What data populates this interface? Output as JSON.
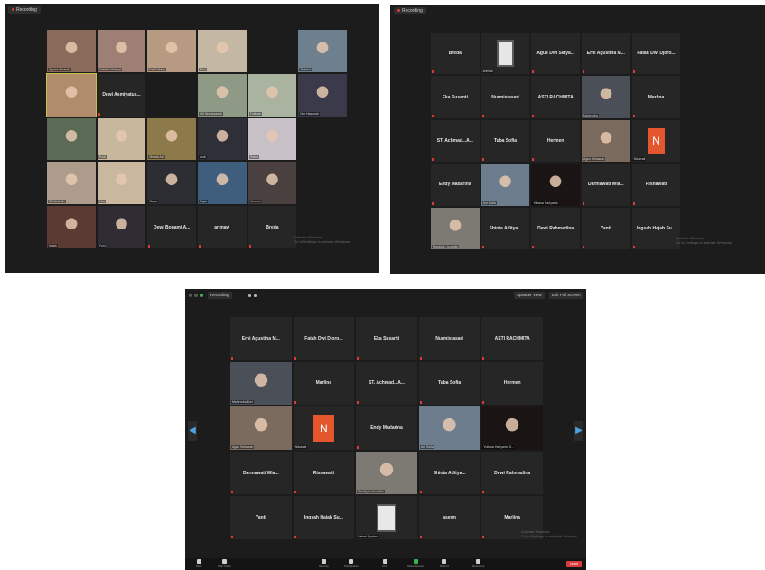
{
  "shot1": {
    "recording_label": "Recording",
    "tiles": [
      {
        "cap": "Alyssa Amanda",
        "kind": "photo",
        "color": "#8a6a5a"
      },
      {
        "cap": "Mahfud Hidayat",
        "kind": "photo",
        "color": "#9e7f73"
      },
      {
        "cap": "Fadli Akbar",
        "kind": "photo",
        "color": "#b79a82"
      },
      {
        "cap": "Rina",
        "kind": "photo",
        "color": "#c4b8a4"
      },
      {
        "cap": "",
        "kind": "empty"
      },
      {
        "cap": "Syahrul",
        "kind": "photo",
        "color": "#6e7f8e"
      },
      {
        "cap": "",
        "kind": "photo",
        "color": "#b08c6a",
        "active": true
      },
      {
        "name": "Dewi Asmiyatus...",
        "cap": "",
        "kind": "name"
      },
      {
        "cap": "",
        "kind": "empty"
      },
      {
        "cap": "Siti Nurhasanah",
        "kind": "photo",
        "color": "#8f9a86"
      },
      {
        "cap": "Fatimah",
        "kind": "photo",
        "color": "#a9b3a0"
      },
      {
        "cap": "Nur Hasanah",
        "kind": "photo",
        "color": "#3a3a4a"
      },
      {
        "cap": "",
        "kind": "photo",
        "color": "#5b6a55"
      },
      {
        "cap": "Rudi",
        "kind": "photo",
        "color": "#c7b89d"
      },
      {
        "cap": "Mellati Asri",
        "kind": "photo",
        "color": "#8c7a4a"
      },
      {
        "cap": "Andi",
        "kind": "photo",
        "color": "#2f2f38"
      },
      {
        "cap": "Ratna",
        "kind": "photo",
        "color": "#c7c0c6"
      },
      {
        "cap": "",
        "kind": "empty"
      },
      {
        "cap": "Siti Aminah",
        "kind": "photo",
        "color": "#ad9c8c"
      },
      {
        "cap": "Lina",
        "kind": "photo",
        "color": "#c9b7a0"
      },
      {
        "cap": "Maya",
        "kind": "photo",
        "color": "#2d2d34"
      },
      {
        "cap": "Fajar",
        "kind": "photo",
        "color": "#3f5e7e"
      },
      {
        "cap": "Hendra",
        "kind": "photo",
        "color": "#4a4040"
      },
      {
        "cap": "",
        "kind": "empty"
      },
      {
        "cap": "Indah",
        "kind": "photo",
        "color": "#5a3b33"
      },
      {
        "cap": "Yuni",
        "kind": "photo",
        "color": "#2f2c34"
      },
      {
        "name": "Dewi Bonami A...",
        "cap": "",
        "kind": "name"
      },
      {
        "name": "arimaw",
        "cap": "",
        "kind": "name"
      },
      {
        "name": "Breda",
        "cap": "",
        "kind": "name"
      },
      {
        "cap": "",
        "kind": "empty"
      }
    ],
    "watermark_line1": "Activate Windows",
    "watermark_line2": "Go to Settings to activate Windows."
  },
  "shot2": {
    "recording_label": "Recording",
    "tiles": [
      {
        "name": "Breda",
        "kind": "name"
      },
      {
        "cap": "arimaw",
        "kind": "icon",
        "color": "#e6e6e6"
      },
      {
        "name": "Agus Dwi Setya...",
        "kind": "name"
      },
      {
        "name": "Erni Agustina M...",
        "kind": "name"
      },
      {
        "name": "Fatah Dwi Djoro...",
        "kind": "name"
      },
      {
        "kind": "empty"
      },
      {
        "name": "Eka Susanti",
        "kind": "name"
      },
      {
        "name": "Nurmistasari",
        "kind": "name"
      },
      {
        "name": "ASTI RACHMITA",
        "kind": "name"
      },
      {
        "cap": "Mahendra",
        "kind": "photo",
        "color": "#4a4f58"
      },
      {
        "name": "Marlina",
        "kind": "name"
      },
      {
        "kind": "empty"
      },
      {
        "name": "ST. Achmad...A...",
        "kind": "name"
      },
      {
        "name": "Tuba Sofia",
        "kind": "name"
      },
      {
        "name": "Hermen",
        "kind": "name"
      },
      {
        "cap": "Agus Setiawan",
        "kind": "photo",
        "color": "#7a6b5e"
      },
      {
        "cap": "Nikamal",
        "kind": "n"
      },
      {
        "kind": "empty"
      },
      {
        "name": "Endy Madarina",
        "kind": "name"
      },
      {
        "cap": "Ani Sofia",
        "kind": "photo",
        "color": "#6d7d8e"
      },
      {
        "cap": "Yuliana Hariyanto",
        "kind": "photo",
        "color": "#1a1414"
      },
      {
        "name": "Darmawati Wia...",
        "kind": "name"
      },
      {
        "name": "Risnawati",
        "kind": "name"
      },
      {
        "kind": "empty"
      },
      {
        "cap": "Mardiyah Junaidin",
        "kind": "photo",
        "color": "#7c7a72"
      },
      {
        "name": "Shinta Aditya...",
        "kind": "name"
      },
      {
        "name": "Dewi Rahmadina",
        "kind": "name"
      },
      {
        "name": "Yanti",
        "kind": "name"
      },
      {
        "name": "Ingsah Hajah Su...",
        "kind": "name"
      },
      {
        "kind": "empty"
      }
    ],
    "watermark_line1": "Activate Windows",
    "watermark_line2": "Go to Settings to activate Windows."
  },
  "shot3": {
    "recording_label": "Recording",
    "speaker_view_label": "Speaker View",
    "exit_fullscreen_label": "Exit Full Screen",
    "nav_prev": "◀",
    "nav_next": "▶",
    "tiles": [
      {
        "name": "Erni Agustina M...",
        "kind": "name"
      },
      {
        "name": "Fatah Dwi Djoro...",
        "kind": "name"
      },
      {
        "name": "Eka Susanti",
        "kind": "name"
      },
      {
        "name": "Nurmistasari",
        "kind": "name"
      },
      {
        "name": "ASTI RACHMITA",
        "kind": "name"
      },
      {
        "cap": "Mahendra Dwi",
        "kind": "photo",
        "color": "#4a4f58"
      },
      {
        "name": "Marlina",
        "kind": "name"
      },
      {
        "name": "ST. Achmad...A...",
        "kind": "name"
      },
      {
        "name": "Tuba Sofia",
        "kind": "name"
      },
      {
        "name": "Hermen",
        "kind": "name"
      },
      {
        "cap": "Agus Setiawan",
        "kind": "photo",
        "color": "#7a6b5e"
      },
      {
        "cap": "Nikamal",
        "kind": "n"
      },
      {
        "name": "Endy Madarina",
        "kind": "name"
      },
      {
        "cap": "Ani Sofia",
        "kind": "photo",
        "color": "#6d7d8e"
      },
      {
        "cap": "Yuliana Hariyanto S...",
        "kind": "photo",
        "color": "#1a1414"
      },
      {
        "name": "Darmawati Wia...",
        "kind": "name"
      },
      {
        "name": "Risnawati",
        "kind": "name"
      },
      {
        "cap": "Mardiyah Junaidin",
        "kind": "photo",
        "color": "#7c7a72"
      },
      {
        "name": "Shinta Aditya...",
        "kind": "name"
      },
      {
        "name": "Dewi Rahmadina",
        "kind": "name"
      },
      {
        "name": "Yanti",
        "kind": "name"
      },
      {
        "name": "Ingsah Hajah Su...",
        "kind": "name"
      },
      {
        "cap": "Fahmi Syahrul",
        "kind": "icon2",
        "color": "#e8e8e8"
      },
      {
        "name": "aserm",
        "kind": "name"
      },
      {
        "name": "Marlina",
        "kind": "name"
      }
    ],
    "toolbar": [
      {
        "label": "Mute",
        "icon": "mic-icon"
      },
      {
        "label": "Start Video",
        "icon": "video-icon"
      },
      {
        "label": "Security",
        "icon": "shield-icon"
      },
      {
        "label": "Participants",
        "icon": "participants-icon"
      },
      {
        "label": "Chat",
        "icon": "chat-icon"
      },
      {
        "label": "Share Screen",
        "icon": "share-icon"
      },
      {
        "label": "Record",
        "icon": "record-icon"
      },
      {
        "label": "Reactions",
        "icon": "reactions-icon"
      }
    ],
    "end_label": "Leave",
    "watermark_line1": "Activate Windows",
    "watermark_line2": "Go to Settings to activate Windows."
  },
  "colors": {
    "accent_green": "#3bb54a",
    "danger": "#d83b3b",
    "nav_arrow": "#4aa3df"
  }
}
